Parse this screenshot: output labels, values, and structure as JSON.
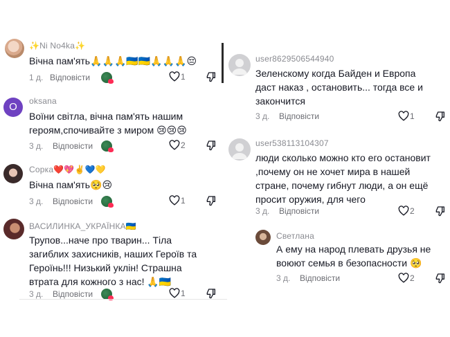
{
  "reply_label": "Відповісти",
  "left_comments": [
    {
      "username": "✨Ni No4ka✨",
      "text": "Вічна пам'ять🙏🙏🙏🇺🇦🇺🇦🙏🙏🙏😔",
      "date": "1 д.",
      "likes": "1"
    },
    {
      "username": "oksana",
      "avatar_letter": "O",
      "text": "Воїни світла, вічна пам'ять нашим героям,спочивайте з миром 😢😢😢",
      "date": "3 д.",
      "likes": "2"
    },
    {
      "username": "Сорка❤️💖✌️💙💛",
      "text": "Вічна пам'ять🥺😢",
      "date": "3 д.",
      "likes": "1"
    },
    {
      "username": "ВАСИЛИНКА_УКРАЇНКА🇺🇦",
      "text": "Трупов...наче про тварин... Тіла загиблих захисників, наших Героїв та Героїнь!!! Низький уклін! Страшна втрата для кожного з нас! 🙏🇺🇦",
      "date": "3 д.",
      "likes": "1"
    }
  ],
  "right_comments": [
    {
      "username": "user8629506544940",
      "text": "Зеленскому когда Байден и Европа даст наказ , остановить... тогда все и закончится",
      "date": "3 д.",
      "likes": "1"
    },
    {
      "username": "user538113104307",
      "text": "люди сколько можно кто его остановит ,почему он не хочет мира в нашей стране, почему гибнут люди, а он ещё просит оружия, для чего",
      "date": "3 д.",
      "likes": "2"
    },
    {
      "username": "Светлана",
      "text": "А ему на народ плевать друзья не воюют семья в безопасности 🥺",
      "date": "3 д.",
      "likes": "2"
    }
  ],
  "colors": {
    "text": "#161823",
    "muted": "#8a8b91",
    "oksana_avatar": "#6f42c1",
    "like_accent": "#fe2c55"
  },
  "icons": {
    "like": "heart-outline-icon",
    "dislike": "thumbs-down-icon"
  }
}
